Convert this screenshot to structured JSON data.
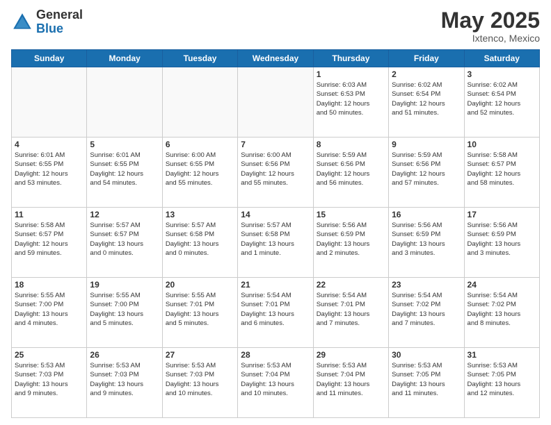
{
  "header": {
    "logo_general": "General",
    "logo_blue": "Blue",
    "month_title": "May 2025",
    "location": "Ixtenco, Mexico"
  },
  "weekdays": [
    "Sunday",
    "Monday",
    "Tuesday",
    "Wednesday",
    "Thursday",
    "Friday",
    "Saturday"
  ],
  "weeks": [
    [
      {
        "day": "",
        "info": ""
      },
      {
        "day": "",
        "info": ""
      },
      {
        "day": "",
        "info": ""
      },
      {
        "day": "",
        "info": ""
      },
      {
        "day": "1",
        "info": "Sunrise: 6:03 AM\nSunset: 6:53 PM\nDaylight: 12 hours\nand 50 minutes."
      },
      {
        "day": "2",
        "info": "Sunrise: 6:02 AM\nSunset: 6:54 PM\nDaylight: 12 hours\nand 51 minutes."
      },
      {
        "day": "3",
        "info": "Sunrise: 6:02 AM\nSunset: 6:54 PM\nDaylight: 12 hours\nand 52 minutes."
      }
    ],
    [
      {
        "day": "4",
        "info": "Sunrise: 6:01 AM\nSunset: 6:55 PM\nDaylight: 12 hours\nand 53 minutes."
      },
      {
        "day": "5",
        "info": "Sunrise: 6:01 AM\nSunset: 6:55 PM\nDaylight: 12 hours\nand 54 minutes."
      },
      {
        "day": "6",
        "info": "Sunrise: 6:00 AM\nSunset: 6:55 PM\nDaylight: 12 hours\nand 55 minutes."
      },
      {
        "day": "7",
        "info": "Sunrise: 6:00 AM\nSunset: 6:56 PM\nDaylight: 12 hours\nand 55 minutes."
      },
      {
        "day": "8",
        "info": "Sunrise: 5:59 AM\nSunset: 6:56 PM\nDaylight: 12 hours\nand 56 minutes."
      },
      {
        "day": "9",
        "info": "Sunrise: 5:59 AM\nSunset: 6:56 PM\nDaylight: 12 hours\nand 57 minutes."
      },
      {
        "day": "10",
        "info": "Sunrise: 5:58 AM\nSunset: 6:57 PM\nDaylight: 12 hours\nand 58 minutes."
      }
    ],
    [
      {
        "day": "11",
        "info": "Sunrise: 5:58 AM\nSunset: 6:57 PM\nDaylight: 12 hours\nand 59 minutes."
      },
      {
        "day": "12",
        "info": "Sunrise: 5:57 AM\nSunset: 6:57 PM\nDaylight: 13 hours\nand 0 minutes."
      },
      {
        "day": "13",
        "info": "Sunrise: 5:57 AM\nSunset: 6:58 PM\nDaylight: 13 hours\nand 0 minutes."
      },
      {
        "day": "14",
        "info": "Sunrise: 5:57 AM\nSunset: 6:58 PM\nDaylight: 13 hours\nand 1 minute."
      },
      {
        "day": "15",
        "info": "Sunrise: 5:56 AM\nSunset: 6:59 PM\nDaylight: 13 hours\nand 2 minutes."
      },
      {
        "day": "16",
        "info": "Sunrise: 5:56 AM\nSunset: 6:59 PM\nDaylight: 13 hours\nand 3 minutes."
      },
      {
        "day": "17",
        "info": "Sunrise: 5:56 AM\nSunset: 6:59 PM\nDaylight: 13 hours\nand 3 minutes."
      }
    ],
    [
      {
        "day": "18",
        "info": "Sunrise: 5:55 AM\nSunset: 7:00 PM\nDaylight: 13 hours\nand 4 minutes."
      },
      {
        "day": "19",
        "info": "Sunrise: 5:55 AM\nSunset: 7:00 PM\nDaylight: 13 hours\nand 5 minutes."
      },
      {
        "day": "20",
        "info": "Sunrise: 5:55 AM\nSunset: 7:01 PM\nDaylight: 13 hours\nand 5 minutes."
      },
      {
        "day": "21",
        "info": "Sunrise: 5:54 AM\nSunset: 7:01 PM\nDaylight: 13 hours\nand 6 minutes."
      },
      {
        "day": "22",
        "info": "Sunrise: 5:54 AM\nSunset: 7:01 PM\nDaylight: 13 hours\nand 7 minutes."
      },
      {
        "day": "23",
        "info": "Sunrise: 5:54 AM\nSunset: 7:02 PM\nDaylight: 13 hours\nand 7 minutes."
      },
      {
        "day": "24",
        "info": "Sunrise: 5:54 AM\nSunset: 7:02 PM\nDaylight: 13 hours\nand 8 minutes."
      }
    ],
    [
      {
        "day": "25",
        "info": "Sunrise: 5:53 AM\nSunset: 7:03 PM\nDaylight: 13 hours\nand 9 minutes."
      },
      {
        "day": "26",
        "info": "Sunrise: 5:53 AM\nSunset: 7:03 PM\nDaylight: 13 hours\nand 9 minutes."
      },
      {
        "day": "27",
        "info": "Sunrise: 5:53 AM\nSunset: 7:03 PM\nDaylight: 13 hours\nand 10 minutes."
      },
      {
        "day": "28",
        "info": "Sunrise: 5:53 AM\nSunset: 7:04 PM\nDaylight: 13 hours\nand 10 minutes."
      },
      {
        "day": "29",
        "info": "Sunrise: 5:53 AM\nSunset: 7:04 PM\nDaylight: 13 hours\nand 11 minutes."
      },
      {
        "day": "30",
        "info": "Sunrise: 5:53 AM\nSunset: 7:05 PM\nDaylight: 13 hours\nand 11 minutes."
      },
      {
        "day": "31",
        "info": "Sunrise: 5:53 AM\nSunset: 7:05 PM\nDaylight: 13 hours\nand 12 minutes."
      }
    ]
  ]
}
